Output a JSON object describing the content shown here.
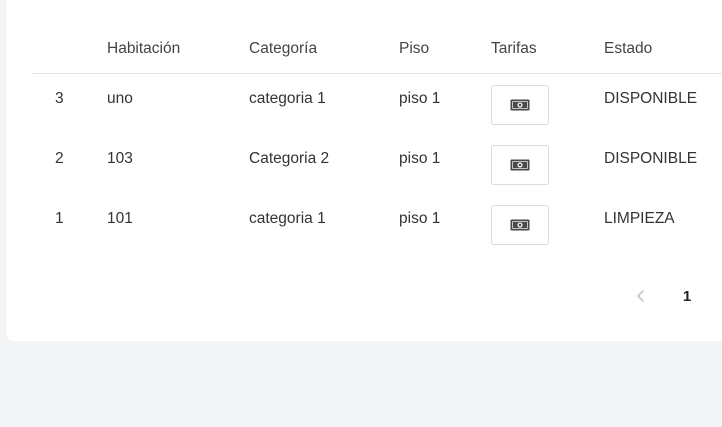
{
  "table": {
    "headers": {
      "id": "",
      "habitacion": "Habitación",
      "categoria": "Categoría",
      "piso": "Piso",
      "tarifas": "Tarifas",
      "estado": "Estado"
    },
    "rows": [
      {
        "id": "3",
        "habitacion": "uno",
        "categoria": "categoria 1",
        "piso": "piso 1",
        "tarifa_icon": "money-icon",
        "estado": "DISPONIBLE"
      },
      {
        "id": "2",
        "habitacion": "103",
        "categoria": "Categoria 2",
        "piso": "piso 1",
        "tarifa_icon": "money-icon",
        "estado": "DISPONIBLE"
      },
      {
        "id": "1",
        "habitacion": "101",
        "categoria": "categoria 1",
        "piso": "piso 1",
        "tarifa_icon": "money-icon",
        "estado": "LIMPIEZA"
      }
    ]
  },
  "pagination": {
    "prev_icon": "chevron-left-icon",
    "current_page": "1"
  },
  "colors": {
    "background": "#f3f4f6",
    "card": "#ffffff",
    "money_icon": "#4a4a4a"
  }
}
